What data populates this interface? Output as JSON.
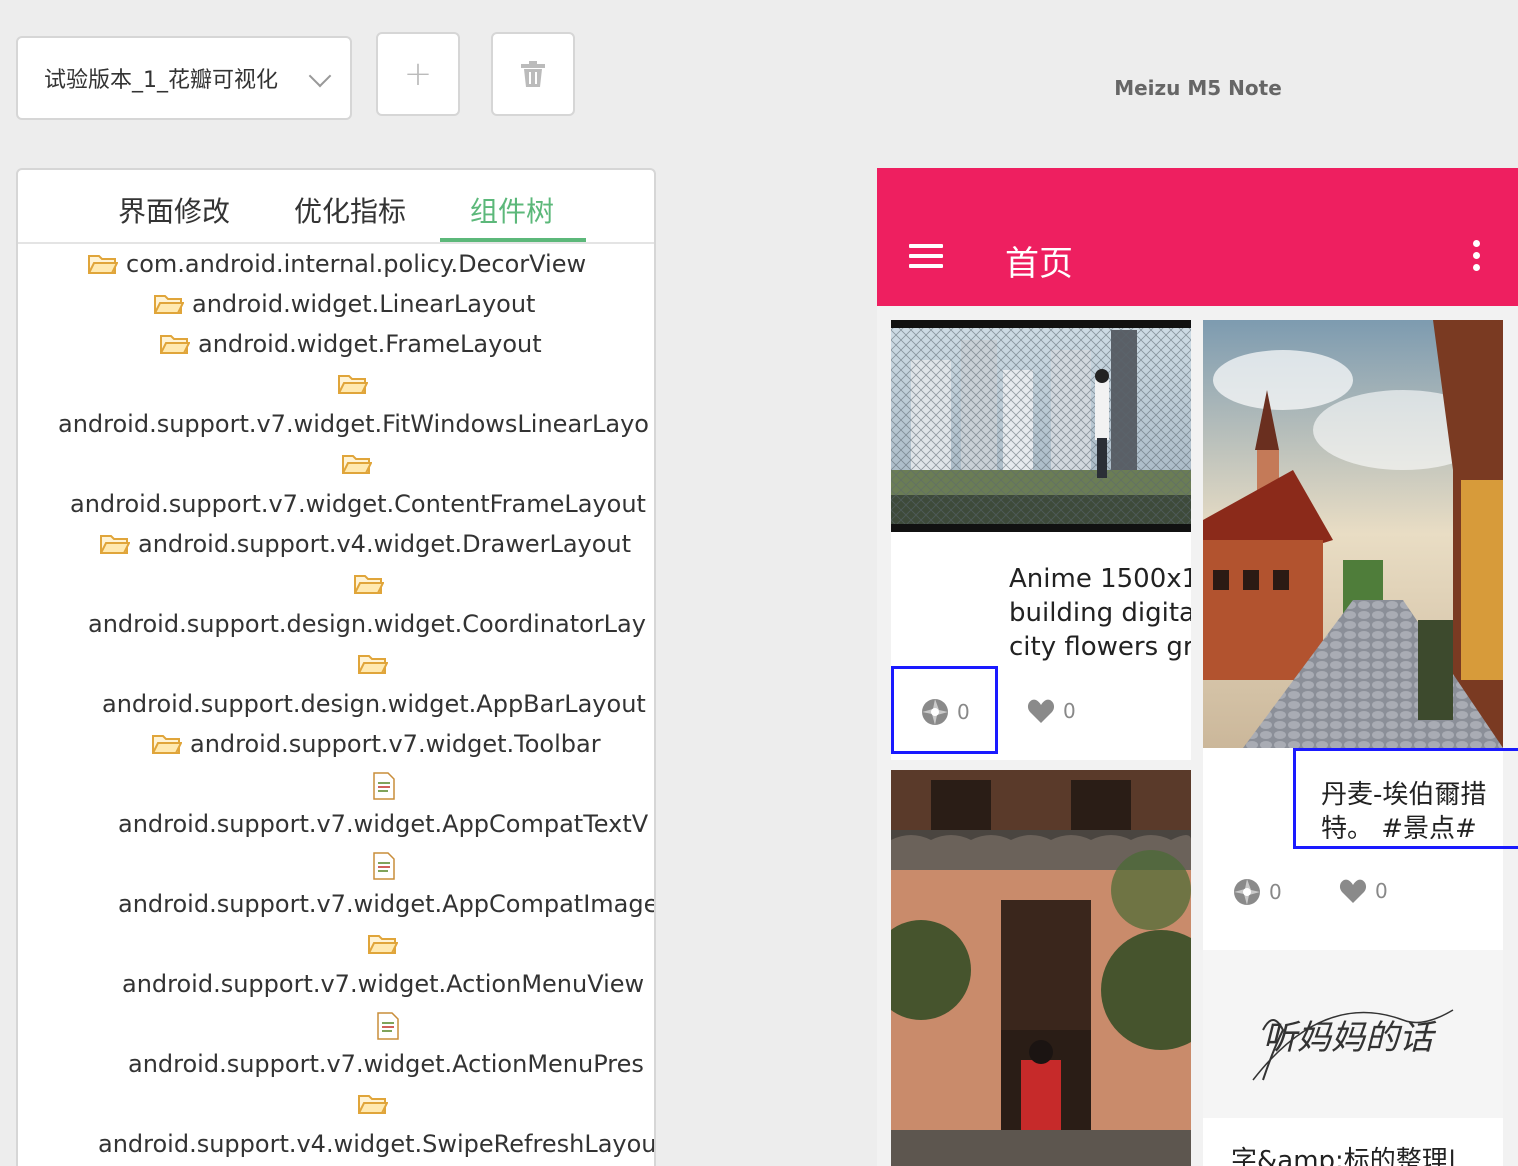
{
  "toolbar": {
    "version_select_value": "试验版本_1_花瓣可视化",
    "add_icon": "plus-icon",
    "delete_icon": "trash-icon"
  },
  "device_name": "Meizu M5 Note",
  "tabs": [
    {
      "label": "界面修改",
      "active": false
    },
    {
      "label": "优化指标",
      "active": false
    },
    {
      "label": "组件树",
      "active": true
    }
  ],
  "tree": [
    {
      "type": "folder",
      "label": "com.android.internal.policy.DecorView"
    },
    {
      "type": "folder",
      "label": "android.widget.LinearLayout"
    },
    {
      "type": "folder",
      "label": "android.widget.FrameLayout"
    },
    {
      "type": "folder",
      "label": "android.support.v7.widget.FitWindowsLinearLayo"
    },
    {
      "type": "folder",
      "label": "android.support.v7.widget.ContentFrameLayout"
    },
    {
      "type": "folder",
      "label": "android.support.v4.widget.DrawerLayout"
    },
    {
      "type": "folder",
      "label": "android.support.design.widget.CoordinatorLay"
    },
    {
      "type": "folder",
      "label": "android.support.design.widget.AppBarLayout"
    },
    {
      "type": "folder",
      "label": "android.support.v7.widget.Toolbar"
    },
    {
      "type": "file",
      "label": "android.support.v7.widget.AppCompatTextV"
    },
    {
      "type": "file",
      "label": "android.support.v7.widget.AppCompatImage"
    },
    {
      "type": "folder",
      "label": "android.support.v7.widget.ActionMenuView"
    },
    {
      "type": "file",
      "label": "android.support.v7.widget.ActionMenuPres"
    },
    {
      "type": "folder",
      "label": "android.support.v4.widget.SwipeRefreshLayou"
    }
  ],
  "screen": {
    "title": "首页",
    "accent": "#ee1f60",
    "cards": [
      {
        "title_lines": [
          "Anime 1500x1",
          "building digita",
          "city flowers gra"
        ],
        "collect": "0",
        "like": "0"
      },
      {
        "title_lines": [
          "丹麦-埃伯爾措",
          "特。 #景点#"
        ],
        "collect": "0",
        "like": "0"
      },
      {
        "handwriting": "听妈妈的话",
        "title_lines": [
          "字&amp;标的整理|"
        ]
      }
    ]
  }
}
